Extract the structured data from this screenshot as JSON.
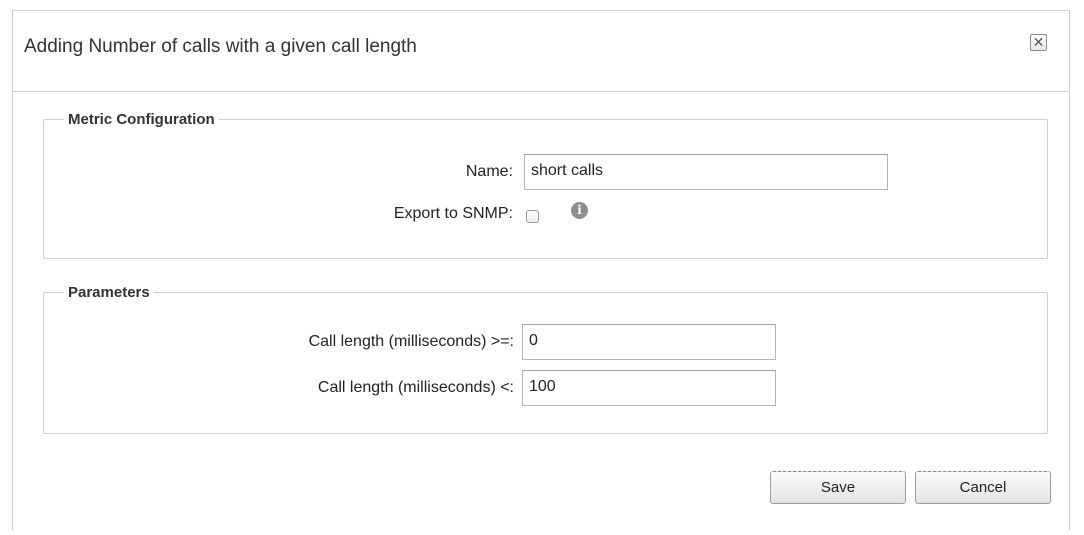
{
  "dialog": {
    "title": "Adding Number of calls with a given call length",
    "close_label": "✕"
  },
  "metric_configuration": {
    "legend": "Metric Configuration",
    "name_label": "Name:",
    "name_value": "short calls",
    "export_label": "Export to SNMP:",
    "export_checked": false,
    "info_icon": "info-icon"
  },
  "parameters": {
    "legend": "Parameters",
    "min_label": "Call length (milliseconds) >=:",
    "min_value": "0",
    "max_label": "Call length (milliseconds) <:",
    "max_value": "100"
  },
  "buttons": {
    "save_label": "Save",
    "cancel_label": "Cancel"
  }
}
